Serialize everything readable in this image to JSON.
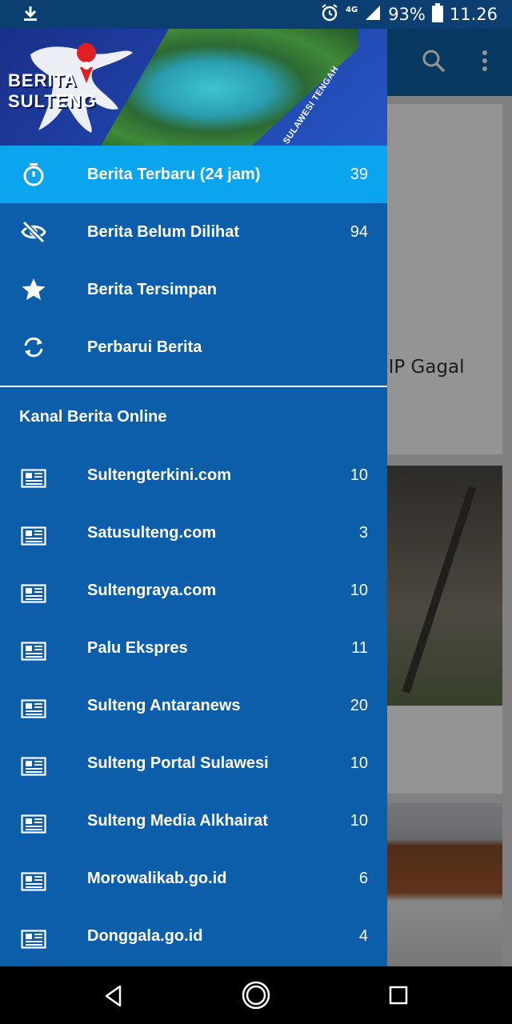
{
  "status_bar": {
    "network": "4G",
    "battery": "93%",
    "time": "11.26",
    "icons": [
      "download-icon",
      "alarm-icon",
      "signal-icon",
      "battery-icon"
    ]
  },
  "app_header": {
    "logo_line1": "BERITA",
    "logo_line2": "SULTENG",
    "slogan": "BERITA SULAWESI TENGAH"
  },
  "menu": [
    {
      "icon": "timer-icon",
      "label": "Berita Terbaru (24 jam)",
      "count": "39",
      "active": true
    },
    {
      "icon": "eye-off-icon",
      "label": "Berita Belum Dilihat",
      "count": "94",
      "active": false
    },
    {
      "icon": "star-icon",
      "label": "Berita Tersimpan",
      "count": "",
      "active": false
    },
    {
      "icon": "refresh-icon",
      "label": "Perbarui Berita",
      "count": "",
      "active": false
    }
  ],
  "channels": {
    "header": "Kanal Berita Online",
    "items": [
      {
        "label": "Sultengterkini.com",
        "count": "10"
      },
      {
        "label": "Satusulteng.com",
        "count": "3"
      },
      {
        "label": "Sultengraya.com",
        "count": "10"
      },
      {
        "label": "Palu Ekspres",
        "count": "11"
      },
      {
        "label": "Sulteng Antaranews",
        "count": "20"
      },
      {
        "label": "Sulteng Portal Sulawesi",
        "count": "10"
      },
      {
        "label": "Sulteng Media Alkhairat",
        "count": "10"
      },
      {
        "label": "Morowalikab.go.id",
        "count": "6"
      },
      {
        "label": "Donggala.go.id",
        "count": "4"
      }
    ]
  },
  "background": {
    "card1_title": "PDIP Gagal"
  },
  "colors": {
    "drawer": "#0d5eaa",
    "active_item": "#0aa4ef",
    "toolbar": "#0d62a7"
  }
}
